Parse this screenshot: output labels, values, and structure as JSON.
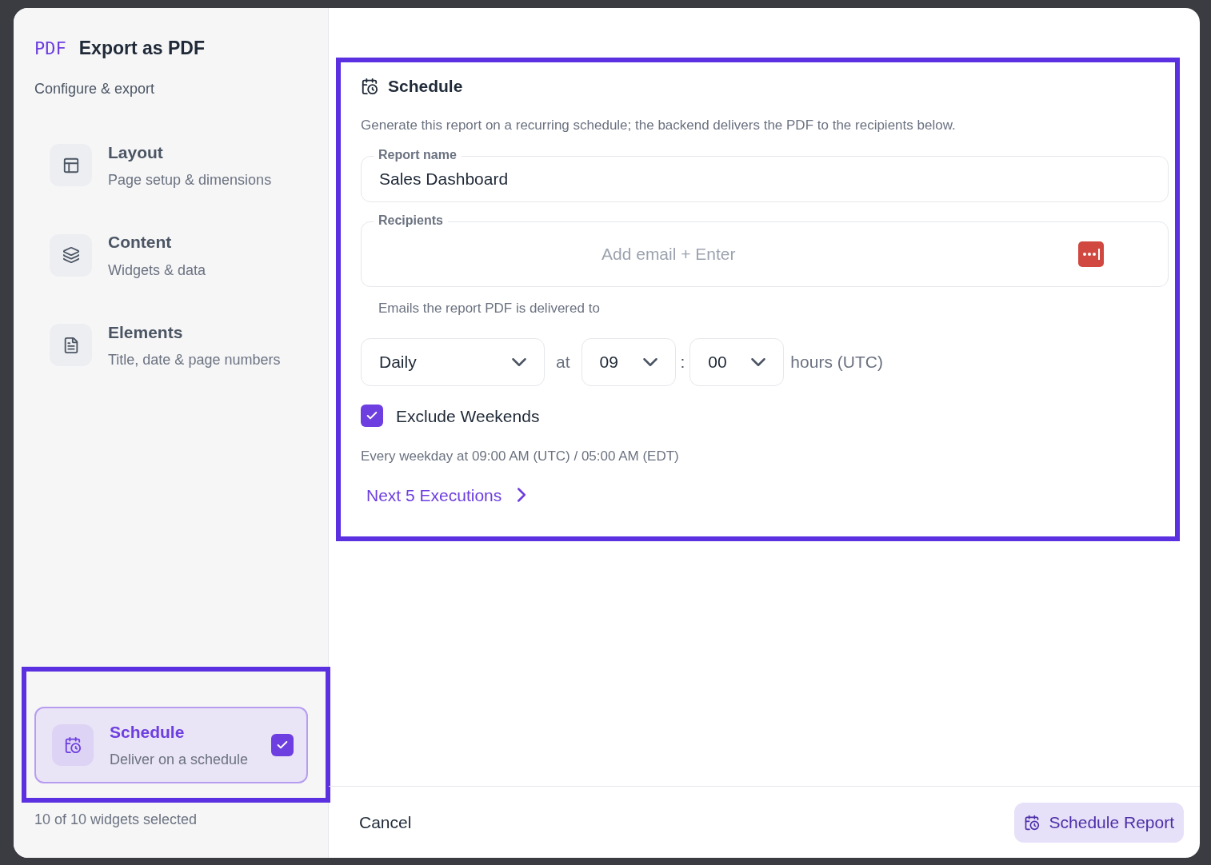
{
  "sidebar": {
    "logo": "PDF",
    "title": "Export as PDF",
    "subtitle": "Configure & export",
    "items": [
      {
        "title": "Layout",
        "subtitle": "Page setup & dimensions",
        "selected": false
      },
      {
        "title": "Content",
        "subtitle": "Widgets & data",
        "selected": false
      },
      {
        "title": "Elements",
        "subtitle": "Title, date & page numbers",
        "selected": false
      }
    ],
    "schedule_item": {
      "title": "Schedule",
      "subtitle": "Deliver on a schedule",
      "selected": true,
      "checked": true
    },
    "selection_summary": "10 of 10 widgets selected"
  },
  "schedule": {
    "title": "Schedule",
    "description": "Generate this report on a recurring schedule; the backend delivers the PDF to the recipients below.",
    "report_name": {
      "label": "Report name",
      "value": "Sales Dashboard"
    },
    "recipients": {
      "label": "Recipients",
      "placeholder": "Add email + Enter",
      "hint": "Emails the report PDF is delivered to"
    },
    "frequency": "Daily",
    "at_label": "at",
    "hour": "09",
    "separator": ":",
    "minute": "00",
    "unit": "hours (UTC)",
    "exclude_weekends": {
      "label": "Exclude Weekends",
      "checked": true
    },
    "summary": "Every weekday at 09:00 AM (UTC) / 05:00 AM (EDT)",
    "next_executions": "Next 5 Executions"
  },
  "footer": {
    "cancel": "Cancel",
    "submit": "Schedule Report"
  }
}
